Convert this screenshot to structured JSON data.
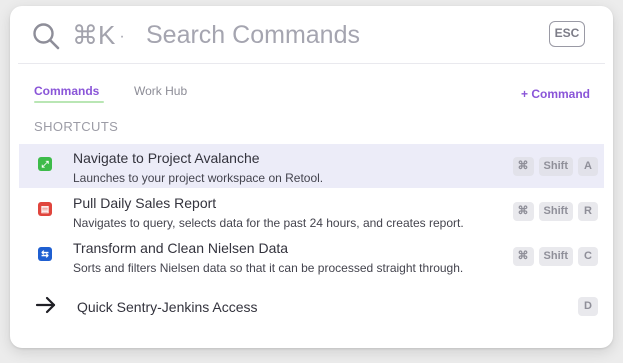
{
  "search": {
    "shortcut_hint": "⌘K",
    "hint_dot": "·",
    "placeholder": "Search Commands",
    "esc_label": "ESC"
  },
  "tabs": [
    {
      "label": "Commands",
      "active": true
    },
    {
      "label": "Work Hub",
      "active": false
    }
  ],
  "add_command_label": "+ Command",
  "section_title": "SHORTCUTS",
  "colors": {
    "accent": "#8a55d8",
    "selected_row": "#ececf8",
    "tab_underline": "#b9e6b4",
    "icon_green": "#3dbb4a",
    "icon_red": "#e0453d",
    "icon_blue": "#1f5fd1"
  },
  "items": [
    {
      "icon": "expand-icon",
      "icon_glyph": "⤢",
      "title": "Navigate to Project Avalanche",
      "description": "Launches to your project workspace on Retool.",
      "keys": [
        "⌘",
        "Shift",
        "A"
      ]
    },
    {
      "icon": "report-icon",
      "icon_glyph": "▤",
      "title": "Pull Daily Sales Report",
      "description": "Navigates to query, selects data for the past 24 hours, and creates report.",
      "keys": [
        "⌘",
        "Shift",
        "R"
      ]
    },
    {
      "icon": "transform-icon",
      "icon_glyph": "⇆",
      "title": "Transform and Clean Nielsen Data",
      "description": "Sorts and filters Nielsen data so that it can be processed straight through.",
      "keys": [
        "⌘",
        "Shift",
        "C"
      ]
    }
  ],
  "quick_access": {
    "icon": "arrow-right-icon",
    "label": "Quick Sentry-Jenkins Access",
    "key": "D"
  }
}
